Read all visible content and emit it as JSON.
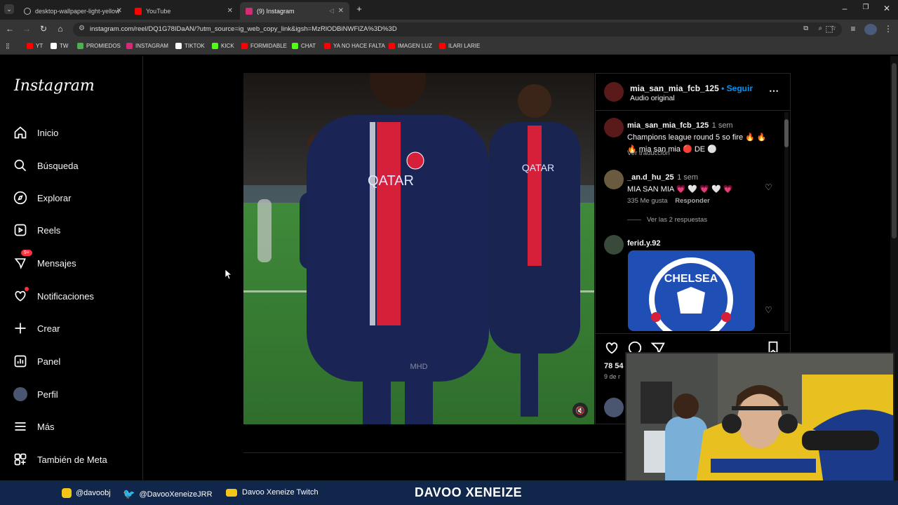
{
  "browser": {
    "tabs": [
      {
        "label": "desktop-wallpaper-light-yellow",
        "color": "#3a6ea5"
      },
      {
        "label": "YouTube",
        "color": "#ff0000"
      },
      {
        "label": "(9) Instagram",
        "color": "#d62976"
      }
    ],
    "url": "instagram.com/reel/DQ1G78IDaAN/?utm_source=ig_web_copy_link&igsh=MzRlODBiNWFlZA%3D%3D",
    "bookmarks": [
      {
        "label": "YT",
        "color": "#ff0000"
      },
      {
        "label": "TW",
        "color": "#ffffff"
      },
      {
        "label": "PROMIEDOS",
        "color": "#4caf50"
      },
      {
        "label": "INSTAGRAM",
        "color": "#d62976"
      },
      {
        "label": "TIKTOK",
        "color": "#ffffff"
      },
      {
        "label": "KICK",
        "color": "#53fc18"
      },
      {
        "label": "FORMIDABLE",
        "color": "#ff0000"
      },
      {
        "label": "CHAT",
        "color": "#53fc18"
      },
      {
        "label": "YA NO HACE FALTA",
        "color": "#ff0000"
      },
      {
        "label": "IMAGEN LUZ",
        "color": "#ff0000"
      },
      {
        "label": "ILARI LARIE",
        "color": "#ff0000"
      }
    ]
  },
  "sidebar": {
    "logo": "Instagram",
    "items": [
      {
        "label": "Inicio",
        "icon": "home-icon"
      },
      {
        "label": "Búsqueda",
        "icon": "search-icon"
      },
      {
        "label": "Explorar",
        "icon": "compass-icon"
      },
      {
        "label": "Reels",
        "icon": "reels-icon"
      },
      {
        "label": "Mensajes",
        "icon": "messenger-icon",
        "badge": "9+"
      },
      {
        "label": "Notificaciones",
        "icon": "heart-icon"
      },
      {
        "label": "Crear",
        "icon": "plus-icon"
      },
      {
        "label": "Panel",
        "icon": "chart-icon"
      },
      {
        "label": "Perfil",
        "icon": "avatar-icon"
      },
      {
        "label": "Más",
        "icon": "menu-icon"
      },
      {
        "label": "También de Meta",
        "icon": "meta-icon"
      }
    ]
  },
  "post": {
    "author": "mia_san_mia_fcb_125",
    "follow": "Seguir",
    "audio": "Audio original",
    "watermark": "MHD",
    "likes": "78 54",
    "date": "9 de r"
  },
  "comments": [
    {
      "user": "mia_san_mia_fcb_125",
      "time": "1 sem",
      "text": "Champions league round 5 so fire 🔥 🔥 🔥 mia san mia 🔴 DE ⚪",
      "translate": "Ver traducción"
    },
    {
      "user": "_an.d_hu_25",
      "time": "1 sem",
      "text": "MIA SAN MIA 💗 🤍 💗 🤍 💗",
      "likes": "335 Me gusta",
      "reply": "Responder",
      "replies": "Ver las 2 respuestas"
    },
    {
      "user": "ferid.y.92",
      "time": "",
      "text": "CHELSEA"
    }
  ],
  "stream": {
    "instagram": "@davoobj",
    "twitter": "@DavooXeneizeJRR",
    "youtube": "Davoo Xeneize Twitch",
    "name": "DAVOO XENEIZE"
  },
  "colors": {
    "accent": "#0095f6",
    "streambar": "#10264a",
    "psg_navy": "#1a2450",
    "psg_red": "#d6203a"
  }
}
